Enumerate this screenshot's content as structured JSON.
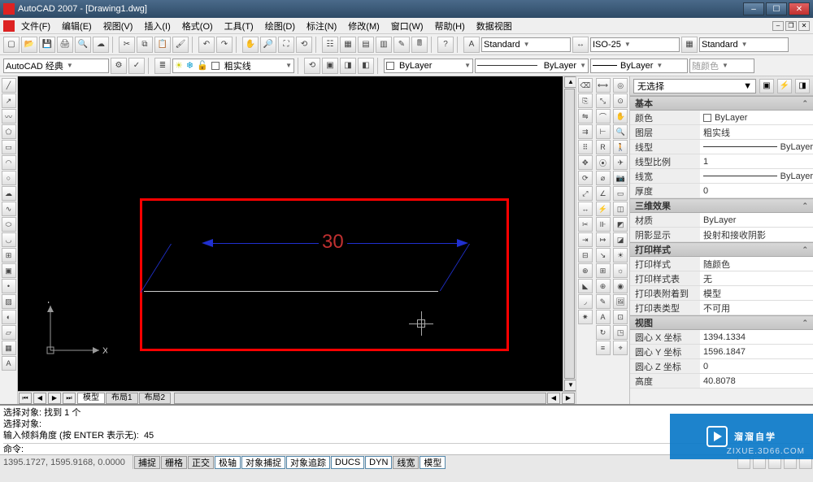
{
  "window": {
    "title": "AutoCAD 2007 - [Drawing1.dwg]"
  },
  "menu": [
    "文件(F)",
    "编辑(E)",
    "视图(V)",
    "插入(I)",
    "格式(O)",
    "工具(T)",
    "绘图(D)",
    "标注(N)",
    "修改(M)",
    "窗口(W)",
    "帮助(H)",
    "数据视图"
  ],
  "workspace": {
    "label": "AutoCAD 经典"
  },
  "layer_combo": "粗实线",
  "color_combo": "ByLayer",
  "ltype_combo": "ByLayer",
  "lweight_combo": "ByLayer",
  "plotstyle_combo": "随颜色",
  "textstyle_combo": "Standard",
  "dimstyle_combo": "ISO-25",
  "tablestyle_combo": "Standard",
  "drawing": {
    "dim_value": "30",
    "ucs_x": "X",
    "ucs_y": "Y"
  },
  "tabs": {
    "model": "模型",
    "layout1": "布局1",
    "layout2": "布局2"
  },
  "props": {
    "selection": "无选择",
    "sections": {
      "basic": {
        "title": "基本",
        "rows": {
          "color_k": "颜色",
          "color_v": "ByLayer",
          "layer_k": "图层",
          "layer_v": "粗实线",
          "ltype_k": "线型",
          "ltype_v": "ByLayer",
          "ltscale_k": "线型比例",
          "ltscale_v": "1",
          "lweight_k": "线宽",
          "lweight_v": "ByLayer",
          "thick_k": "厚度",
          "thick_v": "0"
        }
      },
      "threeD": {
        "title": "三维效果",
        "rows": {
          "material_k": "材质",
          "material_v": "ByLayer",
          "shadow_k": "阴影显示",
          "shadow_v": "投射和接收阴影"
        }
      },
      "plot": {
        "title": "打印样式",
        "rows": {
          "pstyle_k": "打印样式",
          "pstyle_v": "随颜色",
          "ptable_k": "打印样式表",
          "ptable_v": "无",
          "pattach_k": "打印表附着到",
          "pattach_v": "模型",
          "ptype_k": "打印表类型",
          "ptype_v": "不可用"
        }
      },
      "view": {
        "title": "视图",
        "rows": {
          "cx_k": "圆心 X 坐标",
          "cx_v": "1394.1334",
          "cy_k": "圆心 Y 坐标",
          "cy_v": "1596.1847",
          "cz_k": "圆心 Z 坐标",
          "cz_v": "0",
          "h_k": "高度",
          "h_v": "40.8078"
        }
      }
    }
  },
  "cmd": {
    "line1": "选择对象: 找到 1 个",
    "line2": "选择对象:",
    "line3": "输入倾斜角度 (按 ENTER 表示无):  45",
    "prompt": "命令: "
  },
  "status": {
    "coords": "1395.1727, 1595.9168, 0.0000",
    "toggles": [
      "捕捉",
      "栅格",
      "正交",
      "极轴",
      "对象捕捉",
      "对象追踪",
      "DUCS",
      "DYN",
      "线宽",
      "模型"
    ]
  },
  "watermark": {
    "brand": "溜溜自学",
    "sub": "ZIXUE.3D66.COM"
  }
}
